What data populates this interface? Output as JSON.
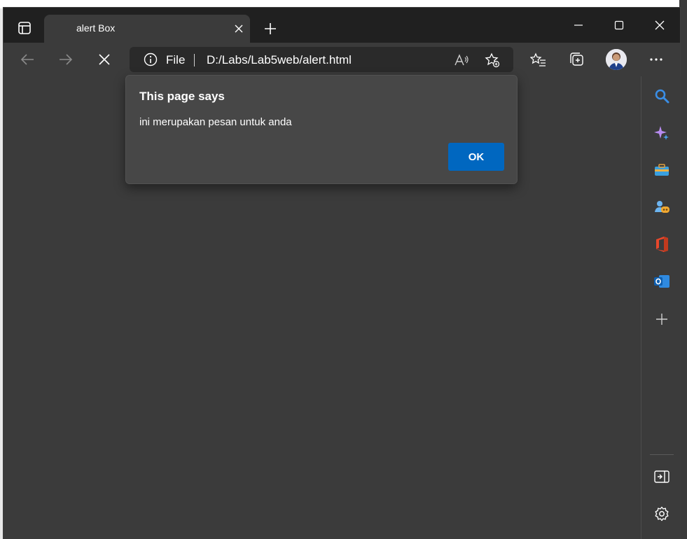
{
  "browser": {
    "tab": {
      "title": "alert Box"
    },
    "address": {
      "scheme_label": "File",
      "url": "D:/Labs/Lab5web/alert.html"
    }
  },
  "dialog": {
    "title": "This page says",
    "message": "ini merupakan pesan untuk anda",
    "ok_label": "OK"
  },
  "colors": {
    "accent": "#0067c0",
    "frame": "#202020",
    "toolbar": "#3b3b3b",
    "dialog": "#474747"
  },
  "sidebar": {
    "icons": [
      "search-icon",
      "copilot-icon",
      "tools-icon",
      "games-icon",
      "office-icon",
      "outlook-icon",
      "add-icon",
      "split-screen-icon",
      "settings-icon"
    ]
  }
}
